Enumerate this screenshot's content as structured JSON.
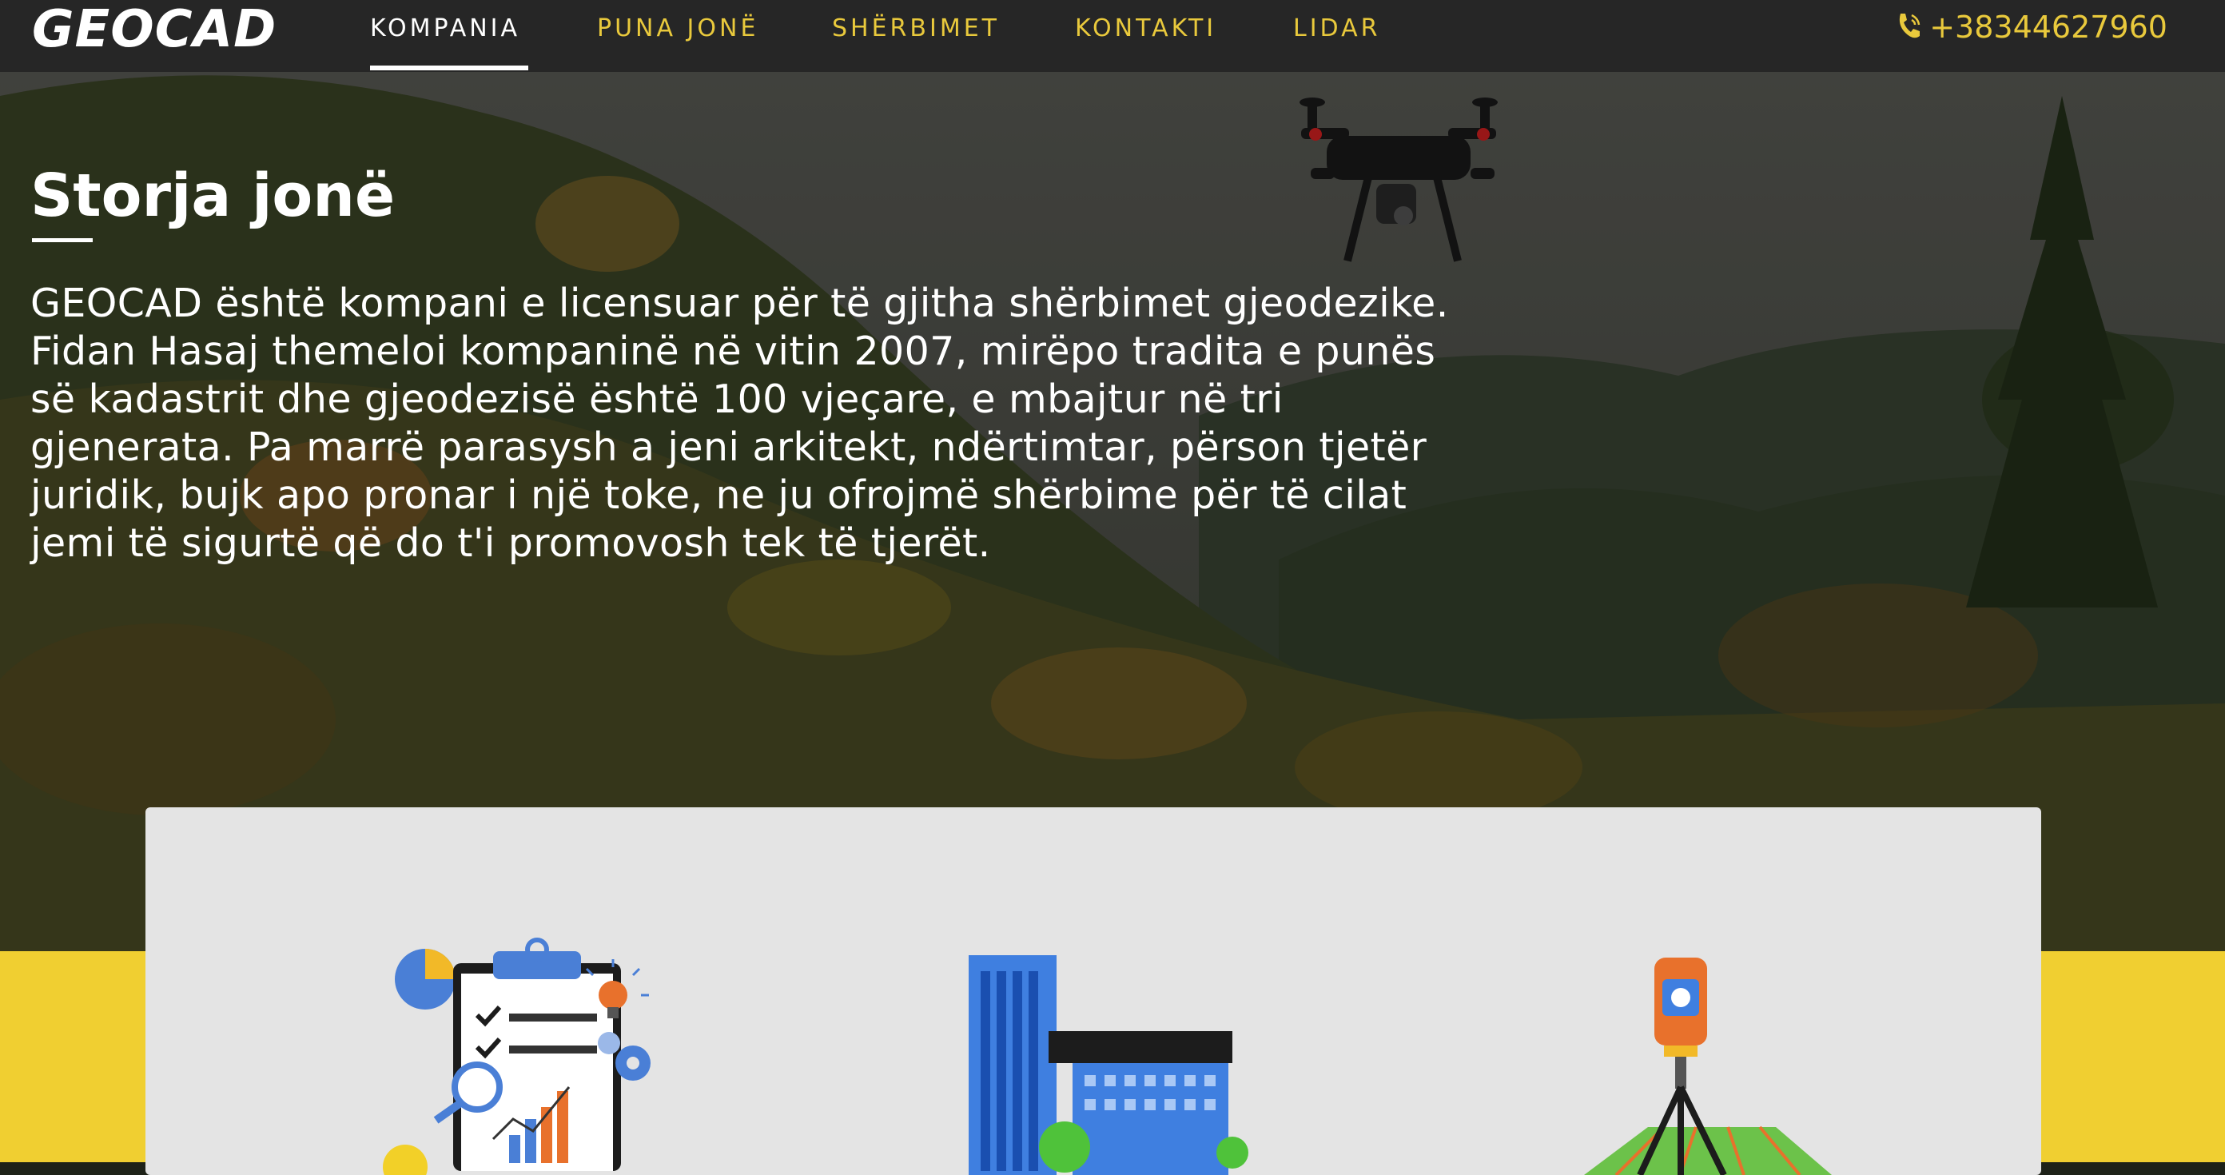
{
  "brand": {
    "logo_text": "GEOCAD"
  },
  "nav": {
    "items": [
      {
        "label": "KOMPANIA",
        "active": true
      },
      {
        "label": "PUNA JONË",
        "active": false
      },
      {
        "label": "SHËRBIMET",
        "active": false
      },
      {
        "label": "KONTAKTI",
        "active": false
      },
      {
        "label": "LIDAR",
        "active": false
      }
    ],
    "phone": "+38344627960"
  },
  "hero": {
    "title": "Storja jonë",
    "text": "GEOCAD është kompani e licensuar për të gjitha shërbimet gjeodezike. Fidan Hasaj themeloi kompaninë në vitin 2007, mirëpo tradita e punës së kadastrit dhe gjeodezisë është 100 vjeçare, e mbajtur në tri gjenerata. Pa marrë parasysh a jeni arkitekt, ndërtimtar, përson tjetër juridik, bujk apo pronar i një toke, ne ju ofrojmë shërbime për të cilat jemi të sigurtë që do t'i promovosh tek të tjerët."
  },
  "services": {
    "icons": [
      "clipboard-report-icon",
      "buildings-icon",
      "survey-tripod-icon"
    ]
  },
  "colors": {
    "accent": "#e9c93c",
    "nav_bg": "#262626",
    "band": "#f0cf31",
    "card": "#e4e4e4"
  }
}
